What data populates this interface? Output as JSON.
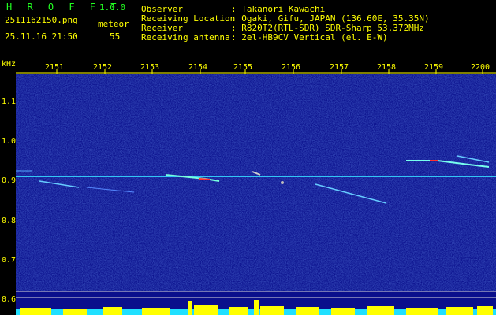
{
  "app": {
    "title": "H R O F F T",
    "version": "1.0.0",
    "filename": "2511162150.png",
    "datetime": "25.11.16 21:50",
    "count_label": "meteor",
    "count_value": "55"
  },
  "info": {
    "rows": [
      {
        "label": "Observer",
        "value": ": Takanori Kawachi"
      },
      {
        "label": "Receiving Location",
        "value": ": Ogaki, Gifu, JAPAN (136.60E, 35.35N)"
      },
      {
        "label": "Receiver",
        "value": ": R820T2(RTL-SDR) SDR-Sharp 53.372MHz"
      },
      {
        "label": "Receiving antenna",
        "value": ": 2el-HB9CV Vertical (el. E-W)"
      }
    ]
  },
  "axes": {
    "unit": "kHz",
    "x_ticks": [
      "2151",
      "2152",
      "2153",
      "2154",
      "2155",
      "2156",
      "2157",
      "2158",
      "2159",
      "2200"
    ],
    "y_ticks": [
      "1.1",
      "1.0",
      "0.9",
      "0.8",
      "0.7",
      "0.6"
    ]
  },
  "colors": {
    "background": "#000000",
    "spectrum_bg": "#0a0f8c",
    "text_yellow": "#ffff00",
    "text_green": "#22ff22",
    "signal_cyan": "#00ffff",
    "level_yellow": "#ffff00"
  }
}
